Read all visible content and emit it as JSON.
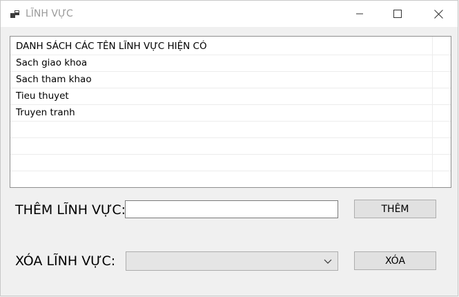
{
  "window": {
    "title": "LĨNH VỰC"
  },
  "list": {
    "header": "DANH SÁCH CÁC TÊN LĨNH VỰC HIỆN CÓ",
    "items": [
      "Sach giao khoa",
      "Sach tham khao",
      "Tieu thuyet",
      "Truyen tranh"
    ]
  },
  "add": {
    "label": "THÊM LĨNH VỰC:",
    "input_value": "",
    "button": "THÊM"
  },
  "remove": {
    "label": "XÓA LĨNH VỰC:",
    "selected": "",
    "button": "XÓA"
  }
}
